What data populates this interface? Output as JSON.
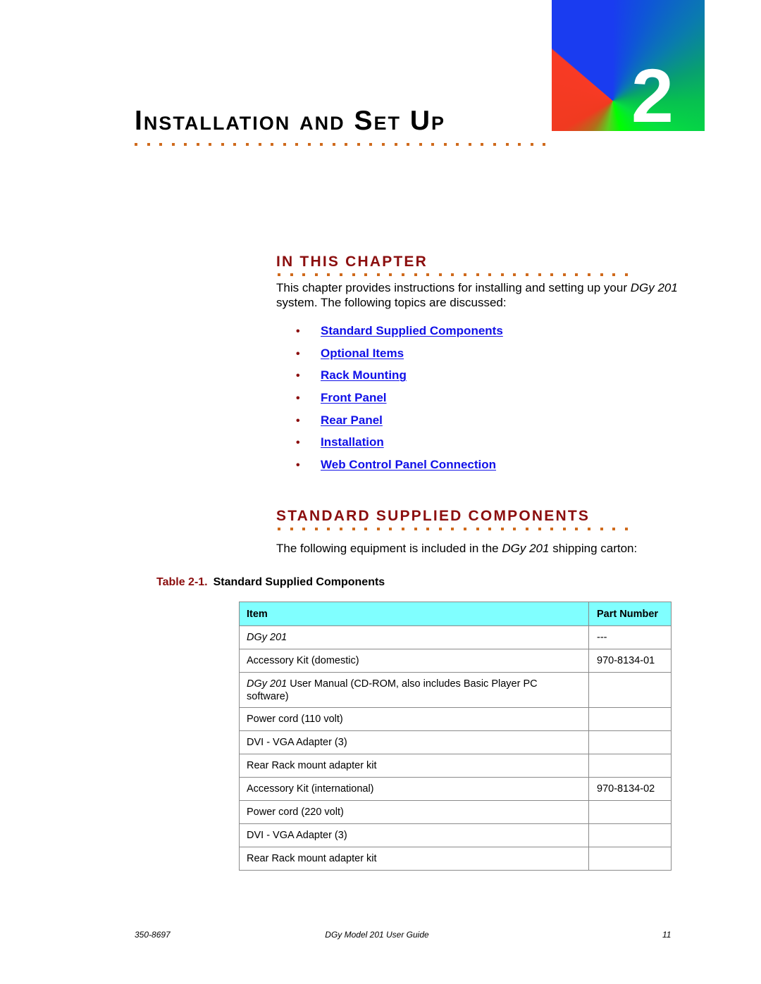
{
  "chapter": {
    "number": "2",
    "title": "Installation and Set Up"
  },
  "in_this_chapter": {
    "heading": "IN THIS CHAPTER",
    "intro_pre": "This chapter provides instructions for installing and setting up your ",
    "intro_product": "DGy 201",
    "intro_post": " system. The following topics are discussed:",
    "topics": [
      "Standard Supplied Components",
      "Optional Items",
      "Rack Mounting",
      "Front Panel",
      "Rear Panel",
      "Installation",
      "Web Control Panel Connection"
    ]
  },
  "standard_components": {
    "heading": "STANDARD SUPPLIED COMPONENTS",
    "intro_pre": "The following equipment is included in the ",
    "intro_product": "DGy 201",
    "intro_post": " shipping carton:",
    "table": {
      "caption_number": "Table 2-1.",
      "caption_title": "Standard Supplied Components",
      "columns": [
        "Item",
        "Part Number"
      ],
      "rows": [
        {
          "item_italic": "DGy 201",
          "item": "",
          "part": "---"
        },
        {
          "item_italic": "",
          "item": "Accessory Kit (domestic)",
          "part": "970-8134-01"
        },
        {
          "item_italic": "DGy 201",
          "item": " User Manual (CD-ROM, also includes Basic Player PC software)",
          "part": ""
        },
        {
          "item_italic": "",
          "item": "Power cord (110 volt)",
          "part": ""
        },
        {
          "item_italic": "",
          "item": "DVI - VGA Adapter (3)",
          "part": ""
        },
        {
          "item_italic": "",
          "item": "Rear Rack mount adapter kit",
          "part": ""
        },
        {
          "item_italic": "",
          "item": "Accessory Kit (international)",
          "part": "970-8134-02"
        },
        {
          "item_italic": "",
          "item": "Power cord (220 volt)",
          "part": ""
        },
        {
          "item_italic": "",
          "item": "DVI - VGA Adapter (3)",
          "part": ""
        },
        {
          "item_italic": "",
          "item": "Rear Rack mount adapter kit",
          "part": ""
        }
      ]
    }
  },
  "footer": {
    "doc_number": "350-8697",
    "guide_title": "DGy Model 201 User Guide",
    "page_number": "11"
  },
  "colors": {
    "heading_red": "#8b0e0e",
    "link_blue": "#1010e8",
    "dot_orange": "#cf6a1c",
    "table_header": "#80ffff"
  }
}
